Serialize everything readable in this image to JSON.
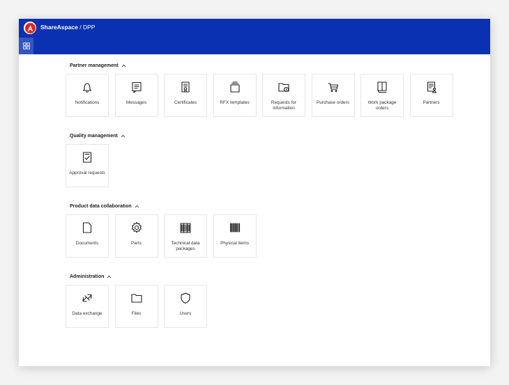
{
  "header": {
    "app_name": "ShareAspace",
    "separator": " / ",
    "context": "DPP"
  },
  "colors": {
    "topbar": "#0a31b2",
    "grid_button": "#3553c2",
    "logo": "#e1251b"
  },
  "sections": [
    {
      "title": "Partner management",
      "tiles": [
        {
          "label": "Notifications",
          "icon": "bell-icon"
        },
        {
          "label": "Messages",
          "icon": "message-icon"
        },
        {
          "label": "Certificates",
          "icon": "certificate-icon"
        },
        {
          "label": "RFX templates",
          "icon": "template-icon"
        },
        {
          "label": "Requests for information",
          "icon": "folder-info-icon"
        },
        {
          "label": "Purchase orders",
          "icon": "cart-icon"
        },
        {
          "label": "Work package orders",
          "icon": "book-icon"
        },
        {
          "label": "Partners",
          "icon": "partner-icon"
        }
      ]
    },
    {
      "title": "Quality management",
      "tiles": [
        {
          "label": "Approval requests",
          "icon": "checklist-icon"
        }
      ]
    },
    {
      "title": "Product data collaboration",
      "tiles": [
        {
          "label": "Documents",
          "icon": "document-icon"
        },
        {
          "label": "Parts",
          "icon": "gear-icon"
        },
        {
          "label": "Technical data packages",
          "icon": "package-icon"
        },
        {
          "label": "Physical items",
          "icon": "barcode-icon"
        }
      ]
    },
    {
      "title": "Administration",
      "tiles": [
        {
          "label": "Data exchange",
          "icon": "exchange-icon"
        },
        {
          "label": "Files",
          "icon": "folder-icon"
        },
        {
          "label": "Users",
          "icon": "shield-icon"
        }
      ]
    }
  ]
}
